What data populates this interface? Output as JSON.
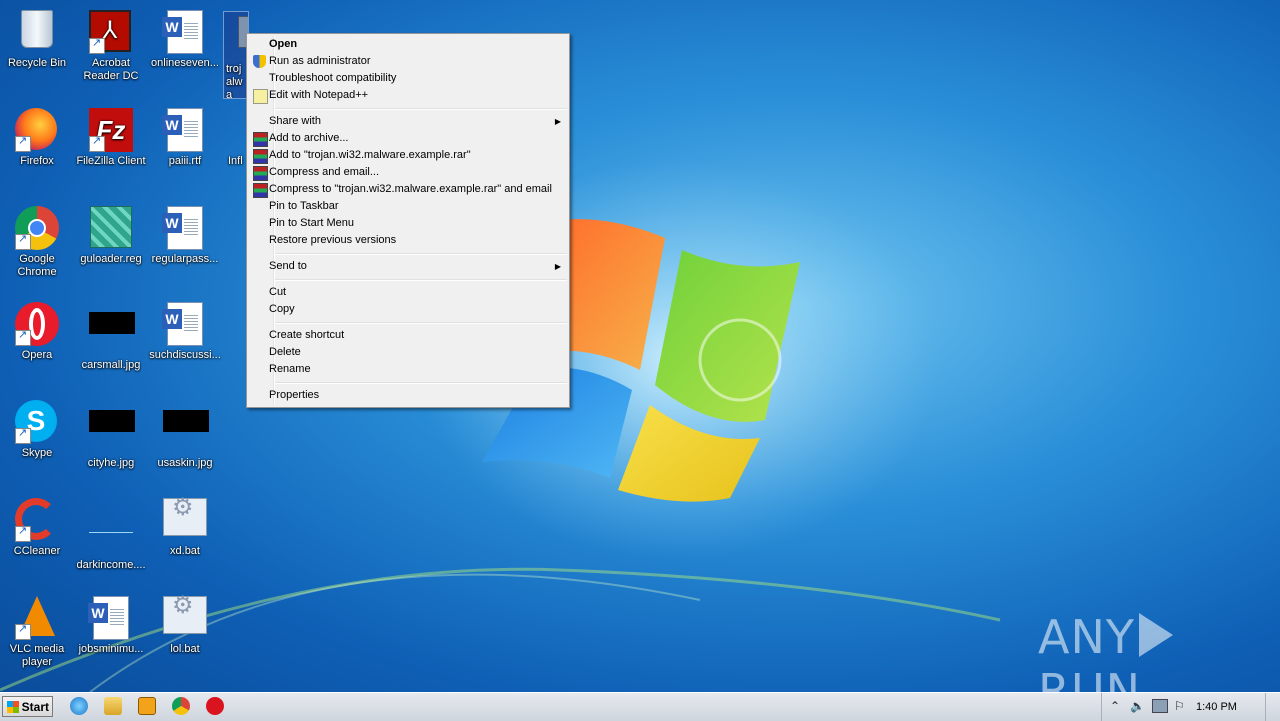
{
  "desktop": {
    "icons": [
      {
        "label": "Recycle Bin"
      },
      {
        "label": "Acrobat Reader DC"
      },
      {
        "label": "onlineseven..."
      },
      {
        "label": "troj alwa"
      },
      {
        "label": "Firefox"
      },
      {
        "label": "FileZilla Client"
      },
      {
        "label": "paiii.rtf"
      },
      {
        "label": "Infl"
      },
      {
        "label": "Google Chrome"
      },
      {
        "label": "guloader.reg"
      },
      {
        "label": "regularpass..."
      },
      {
        "label": "Opera"
      },
      {
        "label": "carsmall.jpg"
      },
      {
        "label": "suchdiscussi..."
      },
      {
        "label": "Skype"
      },
      {
        "label": "cityhe.jpg"
      },
      {
        "label": "usaskin.jpg"
      },
      {
        "label": "CCleaner"
      },
      {
        "label": "darkincome...."
      },
      {
        "label": "xd.bat"
      },
      {
        "label": "VLC media player"
      },
      {
        "label": "jobsminimu..."
      },
      {
        "label": "lol.bat"
      }
    ]
  },
  "context_menu": {
    "items": [
      {
        "label": "Open",
        "icon": "none"
      },
      {
        "label": "Run as administrator",
        "icon": "uac-shield-icon"
      },
      {
        "label": "Troubleshoot compatibility",
        "icon": "none"
      },
      {
        "label": "Edit with Notepad++",
        "icon": "notepad-plus-plus-icon"
      },
      {
        "label": "Share with",
        "icon": "none"
      },
      {
        "label": "Add to archive...",
        "icon": "winrar-icon"
      },
      {
        "label": "Add to \"trojan.wi32.malware.example.rar\"",
        "icon": "winrar-icon"
      },
      {
        "label": "Compress and email...",
        "icon": "winrar-icon"
      },
      {
        "label": "Compress to \"trojan.wi32.malware.example.rar\" and email",
        "icon": "winrar-icon"
      },
      {
        "label": "Pin to Taskbar",
        "icon": "none"
      },
      {
        "label": "Pin to Start Menu",
        "icon": "none"
      },
      {
        "label": "Restore previous versions",
        "icon": "none"
      },
      {
        "label": "Send to",
        "icon": "none"
      },
      {
        "label": "Cut",
        "icon": "none"
      },
      {
        "label": "Copy",
        "icon": "none"
      },
      {
        "label": "Create shortcut",
        "icon": "none"
      },
      {
        "label": "Delete",
        "icon": "none"
      },
      {
        "label": "Rename",
        "icon": "none"
      },
      {
        "label": "Properties",
        "icon": "none"
      }
    ],
    "submenu_arrow": "▶"
  },
  "taskbar": {
    "start_label": "Start",
    "pinned": [
      "internet-explorer-icon",
      "explorer-icon",
      "media-player-icon",
      "chrome-icon",
      "opera-icon"
    ],
    "tray_arrow": "⌃",
    "clock": "1:40 PM"
  },
  "watermark": {
    "left": "ANY",
    "right": "RUN"
  },
  "colors": {
    "menu_bg": "#f0f0f0",
    "taskbar_bg": "#dde2e8",
    "desktop_blue": "#1f7fd0"
  }
}
